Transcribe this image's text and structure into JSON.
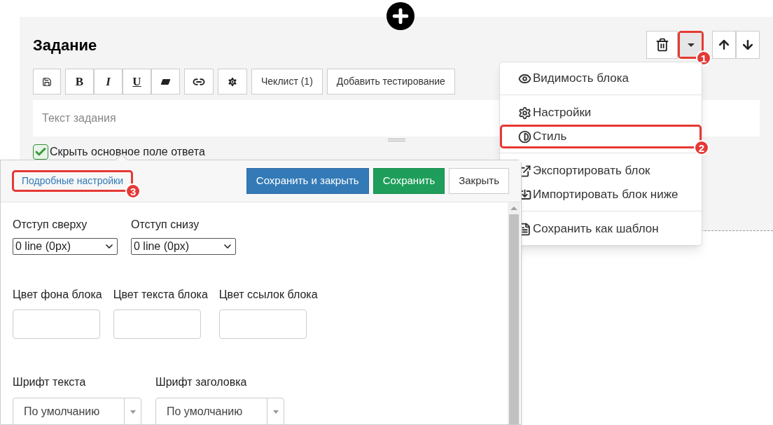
{
  "block": {
    "title": "Задание",
    "caret_callout": "1",
    "format_buttons": [
      "B",
      "I",
      "U"
    ],
    "toolbar_buttons": [
      "Чеклист (1)",
      "Добавить тестирование"
    ],
    "editor": {
      "placeholder": "Текст задания"
    },
    "hide_answer": {
      "label": "Скрыть основное поле ответа",
      "checked": true
    }
  },
  "menu": {
    "groups": [
      [
        {
          "label": "Видимость блока"
        }
      ],
      [
        {
          "label": "Настройки"
        },
        {
          "label": "Стиль",
          "callout": "2"
        }
      ],
      [
        {
          "label": "Экспортировать блок"
        },
        {
          "label": "Импортировать блок ниже"
        }
      ],
      [
        {
          "label": "Сохранить как шаблон"
        }
      ]
    ]
  },
  "style_dialog": {
    "link": "Подробные настройки",
    "link_callout": "3",
    "buttons": [
      {
        "label": "Сохранить и закрыть",
        "kind": "primary"
      },
      {
        "label": "Сохранить",
        "kind": "success"
      },
      {
        "label": "Закрыть",
        "kind": "default"
      }
    ],
    "spacing": [
      {
        "label": "Отступ сверху",
        "value": "0 line (0px)"
      },
      {
        "label": "Отступ снизу",
        "value": "0 line (0px)"
      }
    ],
    "colors": [
      {
        "label": "Цвет фона блока"
      },
      {
        "label": "Цвет текста блока"
      },
      {
        "label": "Цвет ссылок блока"
      }
    ],
    "fonts": [
      {
        "label": "Шрифт текста",
        "value": "По умолчанию"
      },
      {
        "label": "Шрифт заголовка",
        "value": "По умолчанию"
      }
    ]
  }
}
